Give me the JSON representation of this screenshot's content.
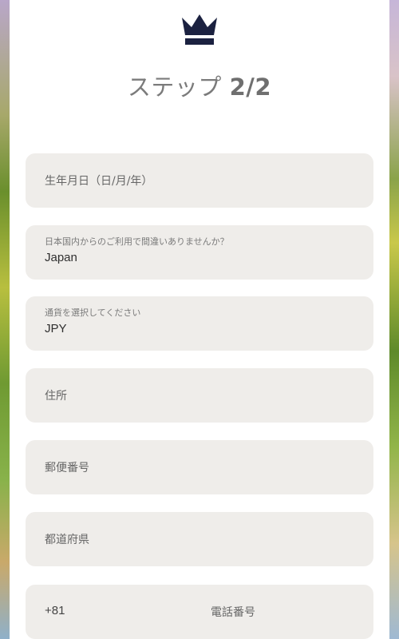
{
  "header": {
    "step_prefix": "ステップ ",
    "step_count": "2/2",
    "logo_icon": "crown-icon",
    "logo_color": "#1b2140"
  },
  "form": {
    "birthdate_placeholder": "生年月日（日/月/年）",
    "country_label": "日本国内からのご利用で間違いありませんか？",
    "country_value": "Japan",
    "currency_label": "通貨を選択してください",
    "currency_value": "JPY",
    "address_placeholder": "住所",
    "postal_placeholder": "郵便番号",
    "prefecture_placeholder": "都道府県",
    "phone_prefix": "+81",
    "phone_placeholder": "電話番号"
  },
  "colors": {
    "field_bg": "#efedea",
    "panel_bg": "#ffffff"
  }
}
